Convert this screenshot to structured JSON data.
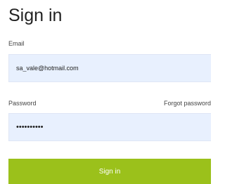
{
  "form": {
    "title": "Sign in",
    "email": {
      "label": "Email",
      "value": "sa_vale@hotmail.com"
    },
    "password": {
      "label": "Password",
      "value": "••••••••••",
      "forgot_link": "Forgot password"
    },
    "submit_label": "Sign in"
  },
  "colors": {
    "input_background": "#e8f0fe",
    "button_background": "#9bc11b",
    "button_text": "#ffffff",
    "title_text": "#222222"
  }
}
